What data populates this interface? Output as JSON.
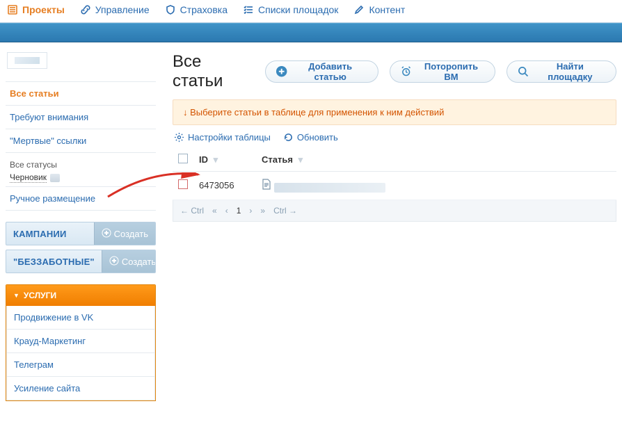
{
  "nav": {
    "projects": "Проекты",
    "manage": "Управление",
    "insurance": "Страховка",
    "sites": "Списки площадок",
    "content": "Контент"
  },
  "sidebar": {
    "all": "Все статьи",
    "attention": "Требуют внимания",
    "dead": "\"Мертвые\" ссылки",
    "statuses": {
      "all": "Все статусы",
      "draft": "Черновик"
    },
    "manual": "Ручное размещение",
    "groups": {
      "campaigns": "КАМПАНИИ",
      "carefree": "\"БЕЗЗАБОТНЫЕ\"",
      "create": "Создать"
    },
    "services": {
      "title": "УСЛУГИ",
      "items": [
        "Продвижение в VK",
        "Крауд-Маркетинг",
        "Телеграм",
        "Усиление сайта"
      ]
    }
  },
  "main": {
    "title": "Все статьи",
    "buttons": {
      "add": "Добавить статью",
      "hurry": "Поторопить ВМ",
      "find": "Найти площадку"
    },
    "notice": "↓  Выберите статьи в таблице для применения к ним действий",
    "tools": {
      "settings": "Настройки таблицы",
      "refresh": "Обновить"
    },
    "columns": {
      "id": "ID",
      "article": "Статья"
    },
    "rows": [
      {
        "id": "6473056"
      }
    ],
    "pager": {
      "prev_hint": "← Ctrl",
      "current": "1",
      "next_hint": "Ctrl →"
    }
  }
}
